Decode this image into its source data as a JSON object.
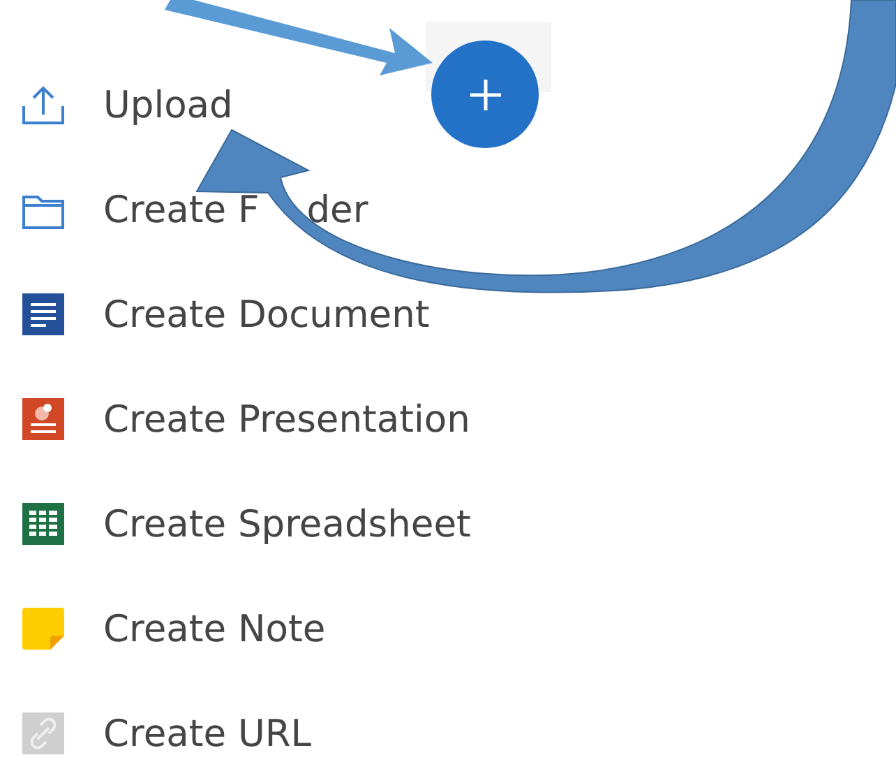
{
  "menu": [
    {
      "kind": "upload",
      "label": "Upload"
    },
    {
      "kind": "folder",
      "label": "Create F",
      "label_end": "der"
    },
    {
      "kind": "document",
      "label": "Create Document"
    },
    {
      "kind": "presentation",
      "label": "Create Presentation"
    },
    {
      "kind": "spreadsheet",
      "label": "Create Spreadsheet"
    },
    {
      "kind": "note",
      "label": "Create Note"
    },
    {
      "kind": "url",
      "label": "Create URL"
    }
  ]
}
